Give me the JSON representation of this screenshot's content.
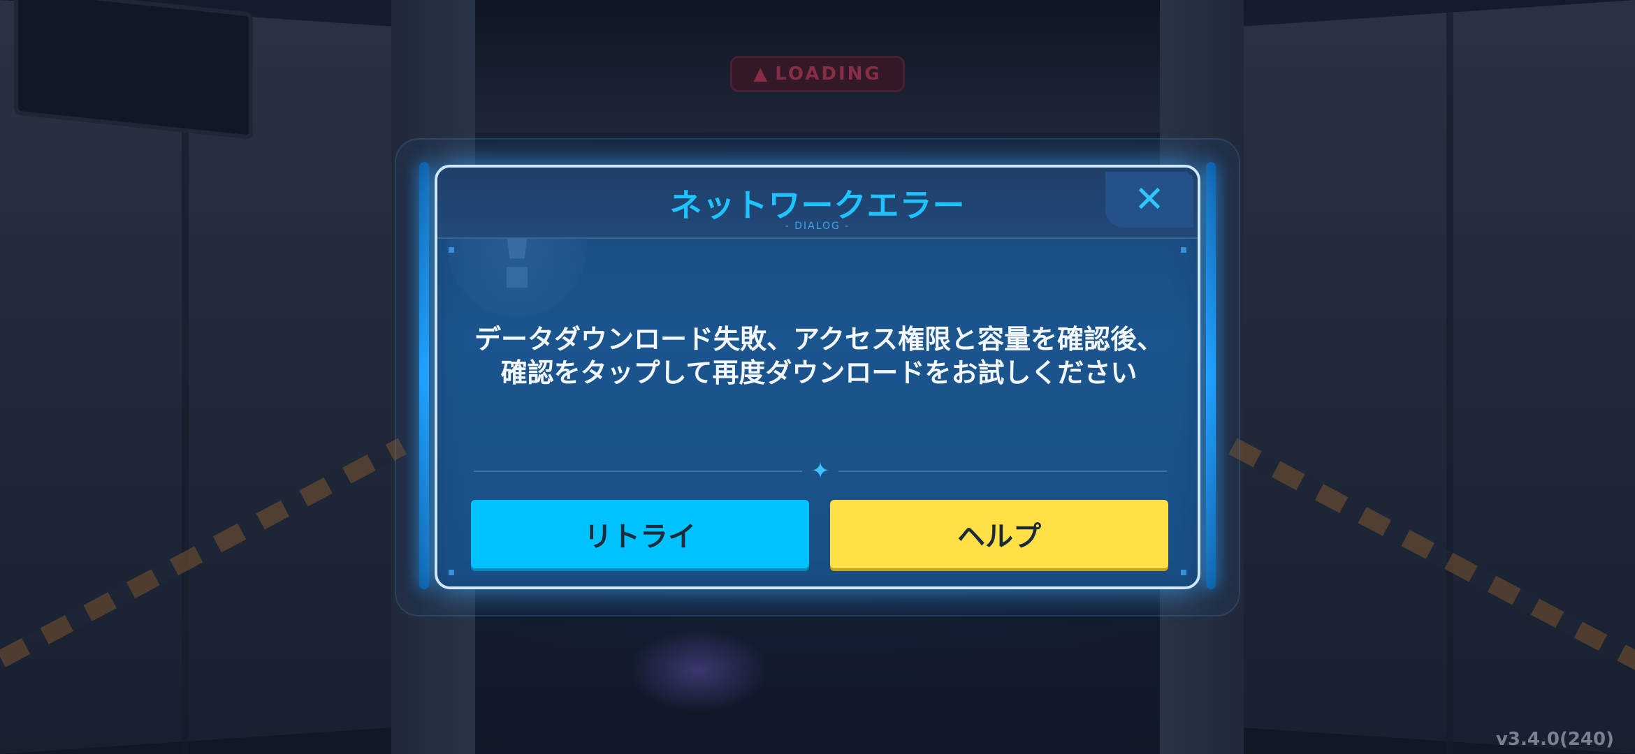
{
  "background": {
    "loading_sign": "LOADING",
    "loading_icon": "warning-triangle-icon"
  },
  "dialog": {
    "title": "ネットワークエラー",
    "subtitle": "- DIALOG -",
    "close_icon": "close-icon",
    "watermark_icon": "exclamation-icon",
    "message_line1": "データダウンロード失敗、アクセス権限と容量を確認後、",
    "message_line2": "確認をタップして再度ダウンロードをお試しください",
    "divider_icon": "sparkle-icon",
    "buttons": {
      "retry_label": "リトライ",
      "help_label": "ヘルプ"
    }
  },
  "version": "v3.4.0(240)",
  "colors": {
    "title": "#1ec3ff",
    "retry_button": "#00c2ff",
    "help_button": "#ffe046",
    "dialog_border": "#cfe8ff"
  }
}
